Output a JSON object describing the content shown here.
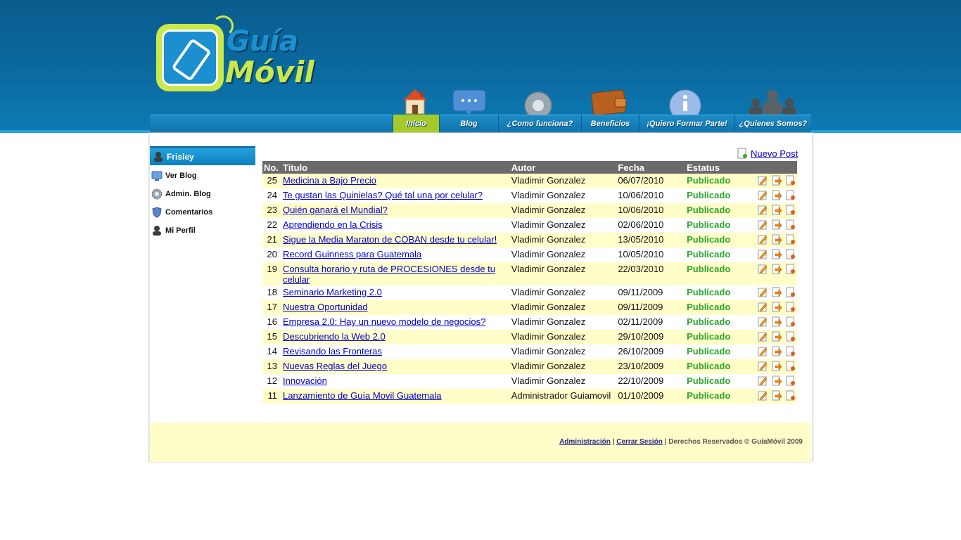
{
  "brand": {
    "line1": "Guía",
    "line2": "Móvil"
  },
  "nav": [
    {
      "label": "Inicio",
      "icon": "home-icon",
      "active": true
    },
    {
      "label": "Blog",
      "icon": "chat-bubble-icon",
      "active": false
    },
    {
      "label": "¿Como funciona?",
      "icon": "gear-icon",
      "active": false
    },
    {
      "label": "Beneficios",
      "icon": "wallet-icon",
      "active": false
    },
    {
      "label": "¡Quiero Formar Parte!",
      "icon": "info-icon",
      "active": false
    },
    {
      "label": "¿Quienes Somos?",
      "icon": "people-icon",
      "active": false
    }
  ],
  "sidebar": {
    "user": "Frisley",
    "items": [
      {
        "label": "Ver Blog",
        "icon": "monitor-icon"
      },
      {
        "label": "Admin. Blog",
        "icon": "gear-icon"
      },
      {
        "label": "Comentarios",
        "icon": "shield-icon"
      },
      {
        "label": "Mi Perfil",
        "icon": "user-icon"
      }
    ]
  },
  "actions": {
    "new_post": "Nuevo Post"
  },
  "table": {
    "headers": [
      "No.",
      "Titulo",
      "Autor",
      "Fecha",
      "Estatus"
    ],
    "rows": [
      {
        "no": "25",
        "title": "Medicina a Bajo Precio",
        "author": "Vladimir Gonzalez",
        "date": "06/07/2010",
        "status": "Publicado"
      },
      {
        "no": "24",
        "title": "Te gustan las Quinielas? Qué tal una por celular?",
        "author": "Vladimir Gonzalez",
        "date": "10/06/2010",
        "status": "Publicado"
      },
      {
        "no": "23",
        "title": "Quién ganará el Mundial?",
        "author": "Vladimir Gonzalez",
        "date": "10/06/2010",
        "status": "Publicado"
      },
      {
        "no": "22",
        "title": "Aprendiendo en la Crisis",
        "author": "Vladimir Gonzalez",
        "date": "02/06/2010",
        "status": "Publicado"
      },
      {
        "no": "21",
        "title": "Sigue la Media Maraton de COBAN desde tu celular!",
        "author": "Vladimir Gonzalez",
        "date": "13/05/2010",
        "status": "Publicado"
      },
      {
        "no": "20",
        "title": "Record Guinness para Guatemala",
        "author": "Vladimir Gonzalez",
        "date": "10/05/2010",
        "status": "Publicado"
      },
      {
        "no": "19",
        "title": "Consulta horario y ruta de PROCESIONES desde tu celular",
        "author": "Vladimir Gonzalez",
        "date": "22/03/2010",
        "status": "Publicado"
      },
      {
        "no": "18",
        "title": "Seminario Marketing 2.0",
        "author": "Vladimir Gonzalez",
        "date": "09/11/2009",
        "status": "Publicado"
      },
      {
        "no": "17",
        "title": "Nuestra Oportunidad",
        "author": "Vladimir Gonzalez",
        "date": "09/11/2009",
        "status": "Publicado"
      },
      {
        "no": "16",
        "title": "Empresa 2.0: Hay un nuevo modelo de negocios?",
        "author": "Vladimir Gonzalez",
        "date": "02/11/2009",
        "status": "Publicado"
      },
      {
        "no": "15",
        "title": "Descubriendo la Web 2.0",
        "author": "Vladimir Gonzalez",
        "date": "29/10/2009",
        "status": "Publicado"
      },
      {
        "no": "14",
        "title": "Revisando las Fronteras",
        "author": "Vladimir Gonzalez",
        "date": "26/10/2009",
        "status": "Publicado"
      },
      {
        "no": "13",
        "title": "Nuevas Reglas del Juego",
        "author": "Vladimir Gonzalez",
        "date": "23/10/2009",
        "status": "Publicado"
      },
      {
        "no": "12",
        "title": "Innovación",
        "author": "Vladimir Gonzalez",
        "date": "22/10/2009",
        "status": "Publicado"
      },
      {
        "no": "11",
        "title": "Lanzamiento de Guía Movil Guatemala",
        "author": "Administrador Guiamovil",
        "date": "01/10/2009",
        "status": "Publicado"
      }
    ]
  },
  "footer": {
    "admin_link": "Administración",
    "sep1": "|",
    "logout_link": "Cerrar Sesión",
    "sep2": "|",
    "rights": "Derechos Reservados © GuíaMóvil 2009"
  },
  "colors": {
    "header_blue": "#0b6aa0",
    "active_nav": "#a5c928",
    "row_highlight": "#fffdc8",
    "status_green": "#2ca82c",
    "link_blue": "#0000cc"
  }
}
